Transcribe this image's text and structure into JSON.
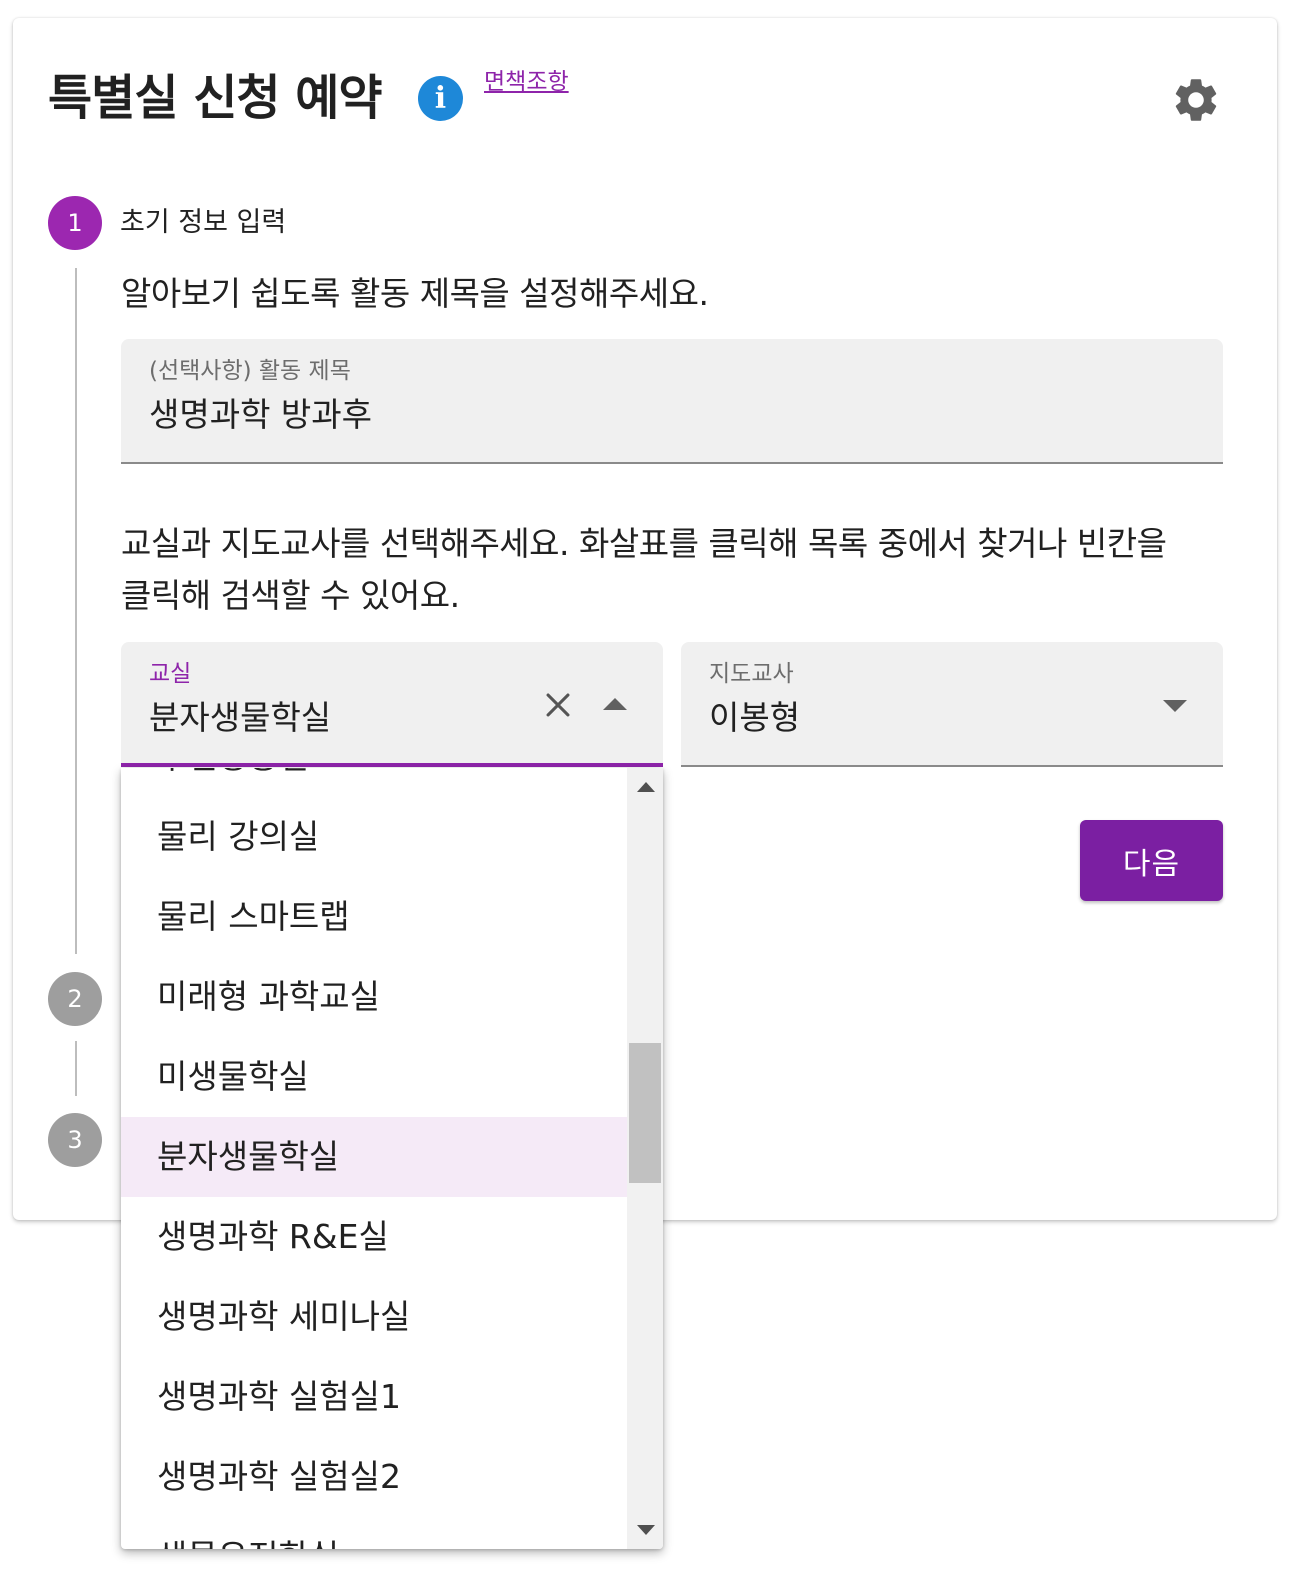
{
  "header": {
    "title": "특별실 신청 예약",
    "info_icon": "info-icon",
    "disclaimer_link": "면책조항",
    "settings_icon": "gear-icon"
  },
  "steps": [
    {
      "number": "1",
      "label": "초기 정보 입력",
      "state": "active"
    },
    {
      "number": "2",
      "label": "",
      "state": "inactive"
    },
    {
      "number": "3",
      "label": "",
      "state": "inactive"
    }
  ],
  "step1": {
    "title_instruction": "알아보기 쉽도록 활동 제목을 설정해주세요.",
    "title_field": {
      "label": "(선택사항) 활동 제목",
      "value": "생명과학 방과후"
    },
    "selection_instruction_line1": "교실과 지도교사를 선택해주세요. 화살표를 클릭해 목록 중에서 찾거나 빈칸을",
    "selection_instruction_line2": "클릭해 검색할 수 있어요.",
    "classroom_field": {
      "label": "교실",
      "value": "분자생물학실",
      "clear_icon": "close-icon",
      "toggle_icon": "arrow-up-icon"
    },
    "teacher_field": {
      "label": "지도교사",
      "value": "이봉형",
      "toggle_icon": "arrow-down-icon"
    },
    "next_button": "다음"
  },
  "dropdown": {
    "options": [
      "무인항공실",
      "물리 강의실",
      "물리 스마트랩",
      "미래형 과학교실",
      "미생물학실",
      "분자생물학실",
      "생명과학 R&E실",
      "생명과학 세미나실",
      "생명과학 실험실1",
      "생명과학 실험실2",
      "생물유전학실"
    ],
    "selected": "분자생물학실"
  },
  "colors": {
    "accent": "#8e24aa",
    "button": "#7b1fa2",
    "info": "#1e88d8",
    "selected_bg": "#f5eaf7"
  }
}
